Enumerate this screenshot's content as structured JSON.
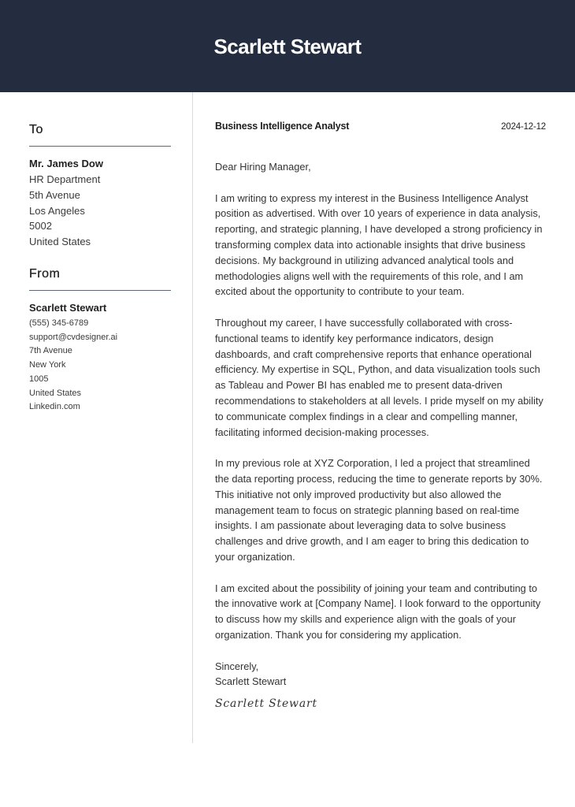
{
  "header": {
    "name": "Scarlett Stewart"
  },
  "colors": {
    "header_background": "#232d3f",
    "header_text": "#ffffff",
    "rule": "#5f6572",
    "divider": "#d9d9d9"
  },
  "sidebar": {
    "to": {
      "title": "To",
      "name": "Mr. James Dow",
      "lines": [
        "HR Department",
        "5th Avenue",
        "Los Angeles",
        "5002",
        "United States"
      ]
    },
    "from": {
      "title": "From",
      "name": "Scarlett Stewart",
      "lines": [
        "(555) 345-6789",
        "support@cvdesigner.ai",
        "7th Avenue",
        "New York",
        "1005",
        "United States",
        "Linkedin.com"
      ]
    }
  },
  "letter": {
    "role": "Business Intelligence Analyst",
    "date": "2024-12-12",
    "salutation": "Dear Hiring Manager,",
    "paragraphs": [
      "I am writing to express my interest in the Business Intelligence Analyst position as advertised. With over 10 years of experience in data analysis, reporting, and strategic planning, I have developed a strong proficiency in transforming complex data into actionable insights that drive business decisions. My background in utilizing advanced analytical tools and methodologies aligns well with the requirements of this role, and I am excited about the opportunity to contribute to your team.",
      "Throughout my career, I have successfully collaborated with cross-functional teams to identify key performance indicators, design dashboards, and craft comprehensive reports that enhance operational efficiency. My expertise in SQL, Python, and data visualization tools such as Tableau and Power BI has enabled me to present data-driven recommendations to stakeholders at all levels. I pride myself on my ability to communicate complex findings in a clear and compelling manner, facilitating informed decision-making processes.",
      "In my previous role at XYZ Corporation, I led a project that streamlined the data reporting process, reducing the time to generate reports by 30%. This initiative not only improved productivity but also allowed the management team to focus on strategic planning based on real-time insights. I am passionate about leveraging data to solve business challenges and drive growth, and I am eager to bring this dedication to your organization.",
      "I am excited about the possibility of joining your team and contributing to the innovative work at [Company Name]. I look forward to the opportunity to discuss how my skills and experience align with the goals of your organization. Thank you for considering my application."
    ],
    "closing": "Sincerely,",
    "closing_name": "Scarlett Stewart",
    "signature": "Scarlett Stewart"
  }
}
